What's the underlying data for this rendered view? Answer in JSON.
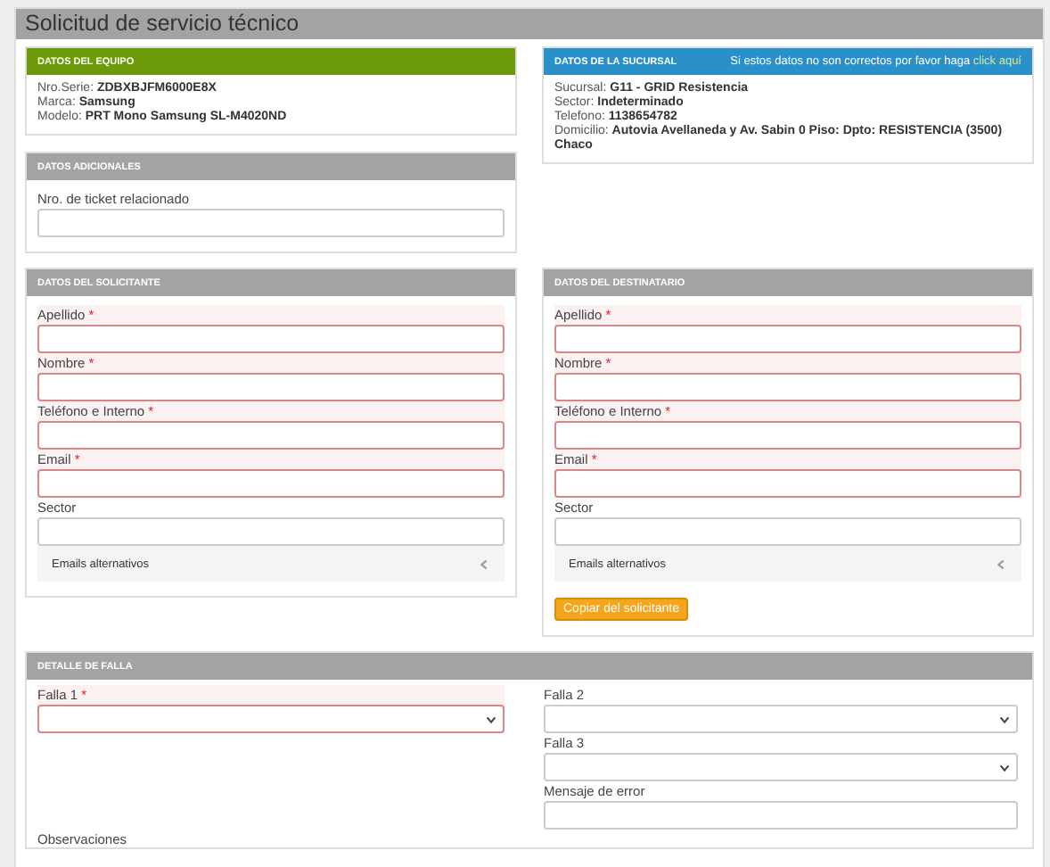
{
  "title": "Solicitud de servicio técnico",
  "equipo": {
    "header": "DATOS DEL EQUIPO",
    "lines": [
      {
        "label": "Nro.Serie:",
        "value": "ZDBXBJFM6000E8X"
      },
      {
        "label": "Marca:",
        "value": "Samsung"
      },
      {
        "label": "Modelo:",
        "value": "PRT Mono Samsung SL-M4020ND"
      }
    ]
  },
  "adicionales": {
    "header": "DATOS ADICIONALES",
    "fields": [
      {
        "label": "Nro. de ticket relacionado",
        "kind": "text",
        "required": false
      }
    ]
  },
  "sucursal": {
    "header": "DATOS DE LA SUCURSAL",
    "notice": "Si estos datos no son correctos por favor haga",
    "link": "click aquí",
    "lines": [
      {
        "label": "Sucursal:",
        "value": "G11 - GRID Resistencia"
      },
      {
        "label": "Sector:",
        "value": "Indeterminado"
      },
      {
        "label": "Telefono:",
        "value": "1138654782"
      },
      {
        "label": "Domicilio:",
        "value": "Autovia Avellaneda y Av. Sabin 0 Piso: Dpto: RESISTENCIA (3500) Chaco"
      }
    ]
  },
  "solicitante": {
    "header": "DATOS DEL SOLICITANTE",
    "fields": [
      {
        "label": "Apellido",
        "marker": "*",
        "kind": "text",
        "required": true
      },
      {
        "label": "Nombre",
        "marker": "*",
        "kind": "text",
        "required": true
      },
      {
        "label": "Teléfono e Interno",
        "marker": "*",
        "kind": "text",
        "required": true
      },
      {
        "label": "Email",
        "marker": "*",
        "kind": "text",
        "required": true
      },
      {
        "label": "Sector",
        "kind": "text",
        "required": false
      }
    ],
    "alternates": {
      "label": "Emails alternativos",
      "expanded": false
    }
  },
  "destinatario": {
    "header": "DATOS DEL DESTINATARIO",
    "fields": [
      {
        "label": "Apellido",
        "marker": "*",
        "kind": "text",
        "required": true
      },
      {
        "label": "Nombre",
        "marker": "*",
        "kind": "text",
        "required": true
      },
      {
        "label": "Teléfono e Interno",
        "marker": "*",
        "kind": "text",
        "required": true
      },
      {
        "label": "Email",
        "marker": "*",
        "kind": "text",
        "required": true
      },
      {
        "label": "Sector",
        "kind": "text",
        "required": false
      }
    ],
    "alternates": {
      "label": "Emails alternativos",
      "expanded": false
    },
    "button": "Copiar del solicitante"
  },
  "falla": {
    "header": "DETALLE DE FALLA",
    "left_fields": [
      {
        "label": "Falla 1",
        "marker": "*",
        "kind": "select",
        "required": true
      }
    ],
    "right_fields": [
      {
        "label": "Falla 2",
        "kind": "select",
        "required": false
      },
      {
        "label": "Falla 3",
        "kind": "select",
        "required": false
      },
      {
        "label": "Mensaje de error",
        "kind": "text",
        "required": false
      }
    ],
    "observaciones": "Observaciones"
  }
}
